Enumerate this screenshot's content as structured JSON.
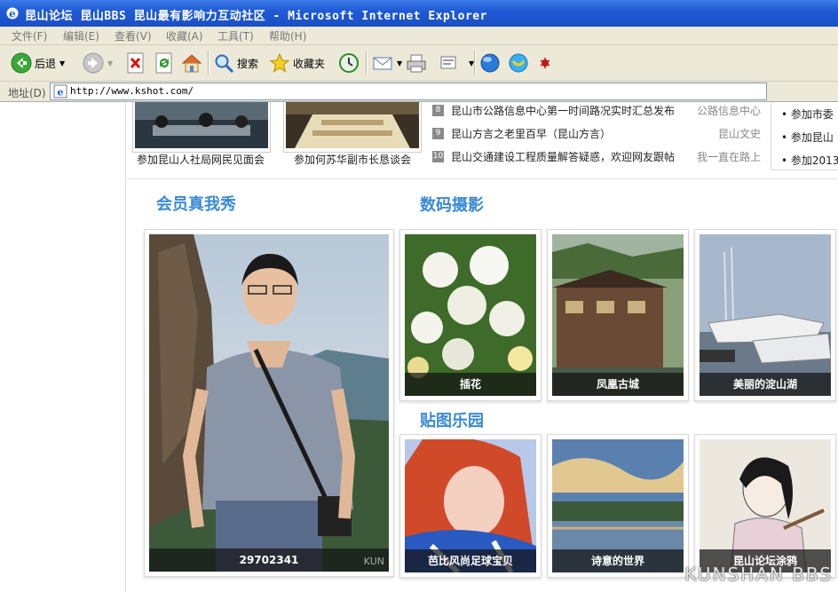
{
  "window": {
    "title": "昆山论坛 昆山BBS 昆山最有影响力互动社区 - Microsoft Internet Explorer"
  },
  "menu": [
    "文件(F)",
    "编辑(E)",
    "查看(V)",
    "收藏(A)",
    "工具(T)",
    "帮助(H)"
  ],
  "toolbar": {
    "back": "后退",
    "search": "搜索",
    "favorites": "收藏夹"
  },
  "address": {
    "label": "地址(D)",
    "url": "http://www.kshot.com/"
  },
  "top_thumbs": [
    {
      "caption": "参加昆山人社局网民见面会"
    },
    {
      "caption": "参加何苏华副市长恳谈会"
    }
  ],
  "news": [
    {
      "num": "8",
      "title": "昆山市公路信息中心第一时间路况实时汇总发布",
      "source": "公路信息中心"
    },
    {
      "num": "9",
      "title": "昆山方言之老里百早（昆山方言）",
      "source": "昆山文史"
    },
    {
      "num": "10",
      "title": "昆山交通建设工程质量解答疑惑，欢迎网友跟帖",
      "source": "我一直在路上"
    }
  ],
  "right_list": [
    "参加市委",
    "参加昆山",
    "参加2013"
  ],
  "sections": {
    "members": "会员真我秀",
    "digital": "数码摄影",
    "stickers": "贴图乐园"
  },
  "member_photo": {
    "caption": "29702341",
    "overlay": "KUN"
  },
  "digital_photos": [
    {
      "caption": "插花"
    },
    {
      "caption": "凤凰古城"
    },
    {
      "caption": "美丽的淀山湖"
    }
  ],
  "sticker_photos": [
    {
      "caption": "芭比风尚足球宝贝"
    },
    {
      "caption": "诗意的世界"
    },
    {
      "caption": "昆山论坛涂鸦"
    }
  ],
  "watermark": "KUNSHAN BBS"
}
